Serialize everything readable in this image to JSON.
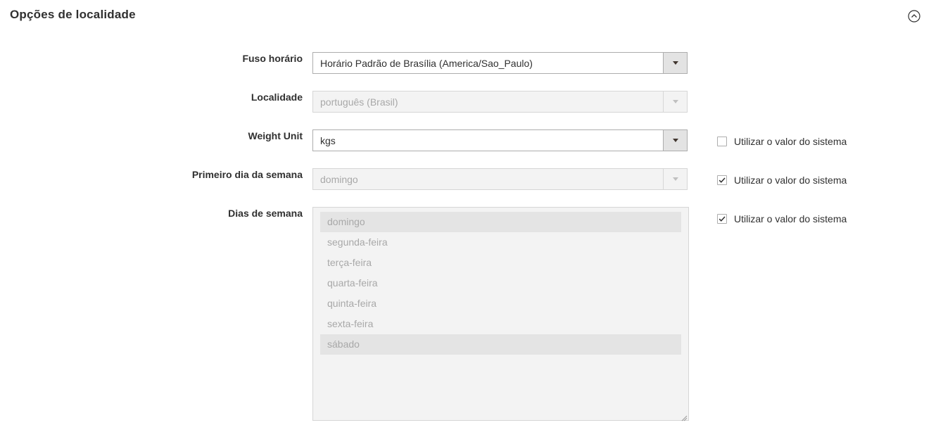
{
  "section": {
    "title": "Opções de localidade",
    "collapse_icon": "chevron-up-circle-icon"
  },
  "fields": {
    "timezone": {
      "label": "Fuso horário",
      "value": "Horário Padrão de Brasília (America/Sao_Paulo)",
      "disabled": false
    },
    "locale": {
      "label": "Localidade",
      "value": "português (Brasil)",
      "disabled": true
    },
    "weight_unit": {
      "label": "Weight Unit",
      "value": "kgs",
      "disabled": false,
      "use_system": {
        "label": "Utilizar o valor do sistema",
        "checked": false
      }
    },
    "first_day": {
      "label": "Primeiro dia da semana",
      "value": "domingo",
      "disabled": true,
      "use_system": {
        "label": "Utilizar o valor do sistema",
        "checked": true
      }
    },
    "weekend_days": {
      "label": "Dias de semana",
      "disabled": true,
      "options": [
        {
          "label": "domingo",
          "selected": true
        },
        {
          "label": "segunda-feira",
          "selected": false
        },
        {
          "label": "terça-feira",
          "selected": false
        },
        {
          "label": "quarta-feira",
          "selected": false
        },
        {
          "label": "quinta-feira",
          "selected": false
        },
        {
          "label": "sexta-feira",
          "selected": false
        },
        {
          "label": "sábado",
          "selected": true
        }
      ],
      "use_system": {
        "label": "Utilizar o valor do sistema",
        "checked": true
      }
    }
  }
}
